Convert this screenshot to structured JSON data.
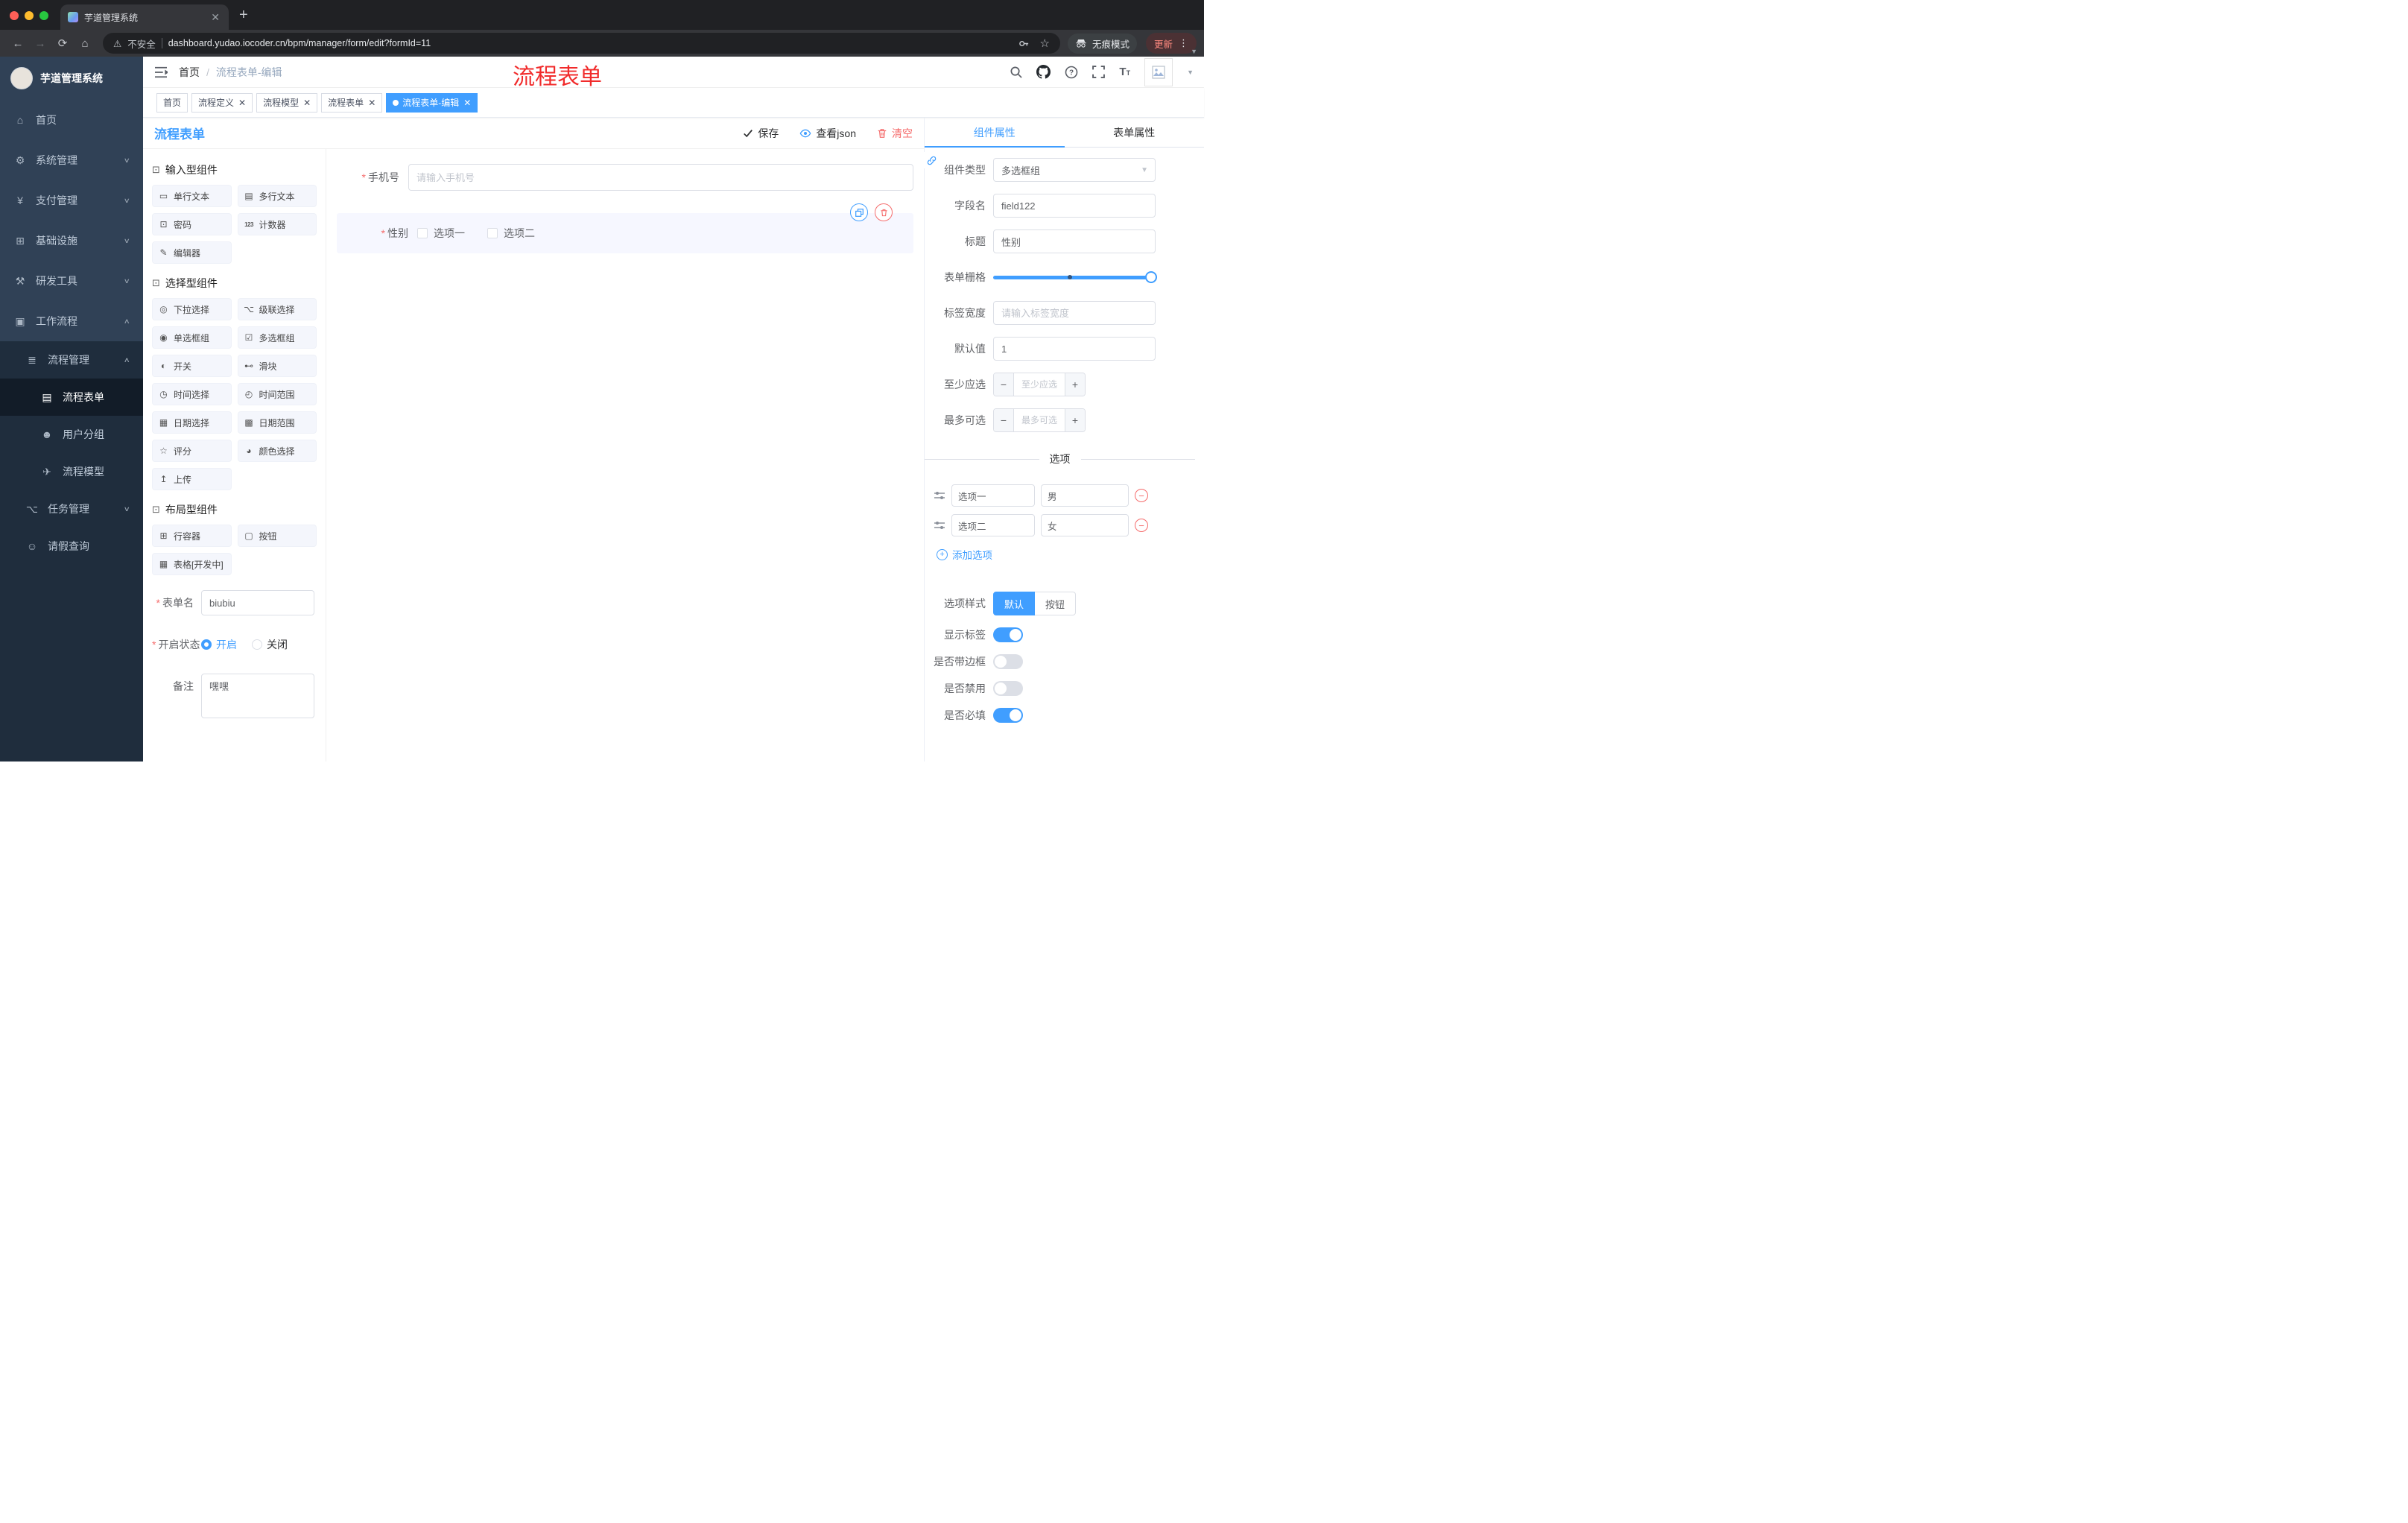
{
  "colors": {
    "accent": "#409eff",
    "danger": "#f56c6c",
    "sidebar_bg": "#304156",
    "sidebar_sub_bg": "#1f2d3d",
    "tag_active_bg": "#409eff",
    "annotation_red": "#f12b2b",
    "traffic_lights": [
      "#ff5f57",
      "#febc2e",
      "#28c840"
    ]
  },
  "browser": {
    "tab_title": "芋道管理系统",
    "security_label": "不安全",
    "url": "dashboard.yudao.iocoder.cn/bpm/manager/form/edit?formId=11",
    "incognito_label": "无痕模式",
    "update_label": "更新"
  },
  "sidebar": {
    "logo_title": "芋道管理系统",
    "menu": [
      {
        "label": "首页",
        "icon": "home-icon"
      },
      {
        "label": "系统管理",
        "icon": "gear-icon"
      },
      {
        "label": "支付管理",
        "icon": "payment-icon"
      },
      {
        "label": "基础设施",
        "icon": "infrastructure-icon"
      },
      {
        "label": "研发工具",
        "icon": "devtools-icon"
      },
      {
        "label": "工作流程",
        "icon": "workflow-icon"
      },
      {
        "label": "流程管理",
        "icon": "process-management-icon"
      },
      {
        "label": "流程表单",
        "icon": "process-form-icon"
      },
      {
        "label": "用户分组",
        "icon": "user-group-icon"
      },
      {
        "label": "流程模型",
        "icon": "process-model-icon"
      },
      {
        "label": "任务管理",
        "icon": "task-management-icon"
      },
      {
        "label": "请假查询",
        "icon": "leave-query-icon"
      }
    ]
  },
  "header": {
    "breadcrumb": [
      "首页",
      "流程表单-编辑"
    ],
    "annotation": "流程表单"
  },
  "tags": [
    {
      "label": "首页"
    },
    {
      "label": "流程定义"
    },
    {
      "label": "流程模型"
    },
    {
      "label": "流程表单"
    },
    {
      "label": "流程表单-编辑"
    }
  ],
  "designer": {
    "title": "流程表单",
    "actions": {
      "save": "保存",
      "view_json": "查看json",
      "clear": "清空"
    },
    "palette": {
      "sections": [
        {
          "title": "输入型组件",
          "items": [
            "单行文本",
            "多行文本",
            "密码",
            "计数器",
            "编辑器"
          ]
        },
        {
          "title": "选择型组件",
          "items": [
            "下拉选择",
            "级联选择",
            "单选框组",
            "多选框组",
            "开关",
            "滑块",
            "时间选择",
            "时间范围",
            "日期选择",
            "日期范围",
            "评分",
            "颜色选择",
            "上传"
          ]
        },
        {
          "title": "布局型组件",
          "items": [
            "行容器",
            "按钮",
            "表格[开发中]"
          ]
        }
      ]
    },
    "meta": {
      "form_name_label": "表单名",
      "form_name_value": "biubiu",
      "status_label": "开启状态",
      "status_on": "开启",
      "status_off": "关闭",
      "remark_label": "备注",
      "remark_value": "嘿嘿"
    },
    "canvas": {
      "phone_label": "手机号",
      "phone_placeholder": "请输入手机号",
      "gender_label": "性别",
      "gender_options": [
        "选项一",
        "选项二"
      ]
    }
  },
  "props": {
    "tabs": [
      "组件属性",
      "表单属性"
    ],
    "component_type_label": "组件类型",
    "component_type_value": "多选框组",
    "field_name_label": "字段名",
    "field_name_value": "field122",
    "title_label": "标题",
    "title_value": "性别",
    "grid_label": "表单栅格",
    "label_width_label": "标签宽度",
    "label_width_placeholder": "请输入标签宽度",
    "default_label": "默认值",
    "default_value": "1",
    "min_label": "至少应选",
    "min_placeholder": "至少应选",
    "max_label": "最多可选",
    "max_placeholder": "最多可选",
    "options_title": "选项",
    "options": [
      {
        "label": "选项一",
        "value": "男"
      },
      {
        "label": "选项二",
        "value": "女"
      }
    ],
    "add_option": "添加选项",
    "option_style_label": "选项样式",
    "option_style_options": [
      "默认",
      "按钮"
    ],
    "show_label_label": "显示标签",
    "border_label": "是否带边框",
    "disabled_label": "是否禁用",
    "required_label": "是否必填"
  }
}
